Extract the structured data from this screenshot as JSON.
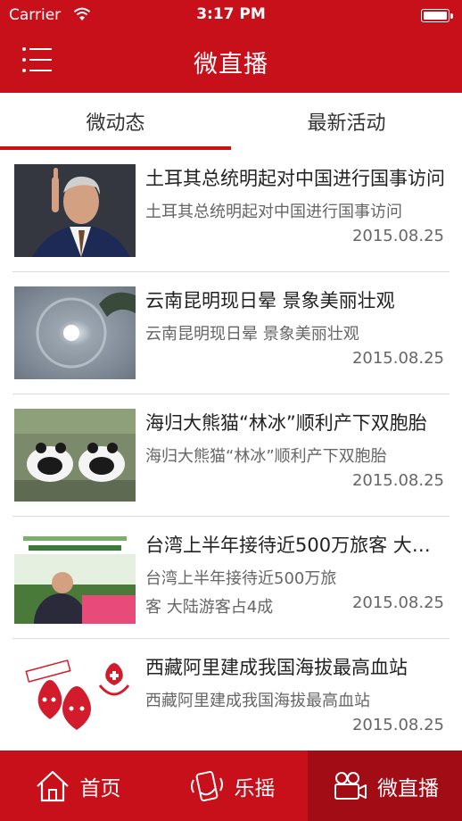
{
  "status": {
    "carrier": "Carrier",
    "time": "3:17 PM"
  },
  "header": {
    "title": "微直播"
  },
  "tabs": [
    {
      "label": "微动态",
      "active": true
    },
    {
      "label": "最新活动",
      "active": false
    }
  ],
  "news": [
    {
      "title": "土耳其总统明起对中国进行国事访问",
      "summary": "土耳其总统明起对中国进行国事访问",
      "date": "2015.08.25",
      "image": "portrait-of-president"
    },
    {
      "title": "云南昆明现日晕 景象美丽壮观",
      "summary": "云南昆明现日晕 景象美丽壮观",
      "date": "2015.08.25",
      "image": "sun-halo"
    },
    {
      "title": "海归大熊猫“林冰”顺利产下双胞胎",
      "summary": "海归大熊猫“林冰”顺利产下双胞胎",
      "date": "2015.08.25",
      "image": "two-pandas"
    },
    {
      "title": "台湾上半年接待近500万旅客 大陆游客占4成",
      "summary": "台湾上半年接待近500万旅客 大陆游客占4成",
      "date": "2015.08.25",
      "image": "speaker-at-event"
    },
    {
      "title": "西藏阿里建成我国海拔最高血站",
      "summary": "西藏阿里建成我国海拔最高血站",
      "date": "2015.08.25",
      "image": "blood-drop-cartoon"
    }
  ],
  "tabbar": [
    {
      "label": "首页",
      "icon": "home-icon"
    },
    {
      "label": "乐摇",
      "icon": "shake-phone-icon"
    },
    {
      "label": "微直播",
      "icon": "video-camera-icon",
      "active": true
    }
  ],
  "colors": {
    "brand": "#c8101b",
    "brand_dark": "#a10c15"
  }
}
